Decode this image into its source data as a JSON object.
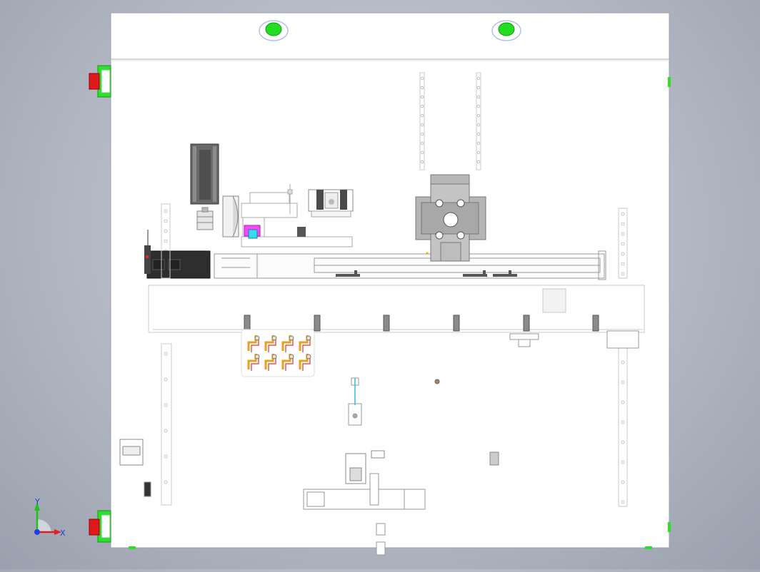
{
  "viewport": {
    "background": "#b8bdc8",
    "plate_color": "#ffffff",
    "edge_color": "#9da3ad"
  },
  "triad": {
    "x_label": "X",
    "y_label": "Y",
    "x_color": "#e02020",
    "y_color": "#20c020",
    "z_color": "#2040e0"
  },
  "indicators": {
    "green_lamp_color": "#22dd22",
    "red_block_color": "#e01818",
    "green_bracket_color": "#2ce02c"
  },
  "components": {
    "servo_motor_color": "#666666",
    "controller_color": "#3a3a3a",
    "magenta_part_color": "#ff44ff",
    "cyan_part_color": "#33ddee",
    "cable_color": "#e8a020",
    "cable_red_color": "#e03030",
    "rail_color": "#cfcfcf"
  }
}
